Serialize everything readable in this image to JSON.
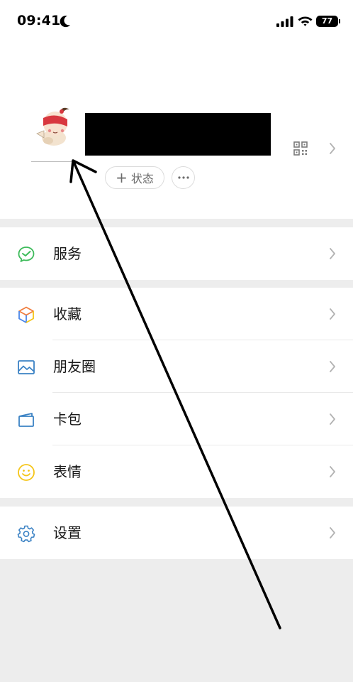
{
  "status_bar": {
    "time": "09:41",
    "battery": "77",
    "icons": [
      "moon-icon",
      "signal-icon",
      "wifi-icon",
      "battery-icon"
    ]
  },
  "profile": {
    "name": "",
    "status_button_label": "状态",
    "more_icon": "ellipsis-icon",
    "qr_icon": "qr-code-icon"
  },
  "menu": {
    "group1": [
      {
        "label": "服务",
        "icon": "services-icon",
        "color": "#3dbb5a"
      }
    ],
    "group2": [
      {
        "label": "收藏",
        "icon": "favorites-cube-icon",
        "color": "#4a86e8"
      },
      {
        "label": "朋友圈",
        "icon": "moments-image-icon",
        "color": "#3b82c4"
      },
      {
        "label": "卡包",
        "icon": "card-wallet-icon",
        "color": "#3b82c4"
      },
      {
        "label": "表情",
        "icon": "stickers-smiley-icon",
        "color": "#f5c518"
      }
    ],
    "group3": [
      {
        "label": "设置",
        "icon": "settings-gear-icon",
        "color": "#3b82c4"
      }
    ]
  },
  "colors": {
    "background": "#ededed",
    "card": "#ffffff",
    "text": "#191919",
    "chevron": "#b2b2b2"
  }
}
